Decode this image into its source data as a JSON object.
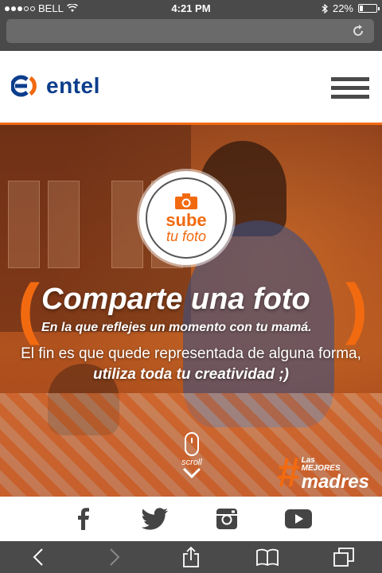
{
  "status_bar": {
    "carrier": "BELL",
    "time": "4:21 PM",
    "battery": "22%",
    "battery_level": 0.22,
    "icons": [
      "signal-dots",
      "wifi-icon",
      "bluetooth-icon",
      "battery-icon"
    ]
  },
  "browser": {
    "url": "",
    "reload_icon": "reload-icon",
    "toolbar": [
      "back-icon",
      "forward-icon",
      "share-icon",
      "bookmarks-icon",
      "tabs-icon"
    ]
  },
  "header": {
    "brand": "entel",
    "menu_icon": "hamburger-menu-icon"
  },
  "hero": {
    "badge": {
      "title": "sube",
      "subtitle": "tu foto",
      "icon": "camera-icon"
    },
    "paren_left": "(",
    "paren_right": ")",
    "headline": "Comparte una foto",
    "subline": "En la que reflejes un momento con tu mamá.",
    "body_plain": "El fin es que quede representada de alguna forma,",
    "body_bold": "utiliza toda tu creatividad ;)",
    "scroll_label": "scroll",
    "hashtag": {
      "symbol": "#",
      "small": "Las",
      "middle": "MEJORES",
      "big": "madres"
    }
  },
  "social": [
    "facebook-icon",
    "twitter-icon",
    "instagram-icon",
    "youtube-icon"
  ],
  "colors": {
    "accent": "#f26a10",
    "brand_blue": "#0c3d8c",
    "chrome": "#4a4a4a"
  }
}
